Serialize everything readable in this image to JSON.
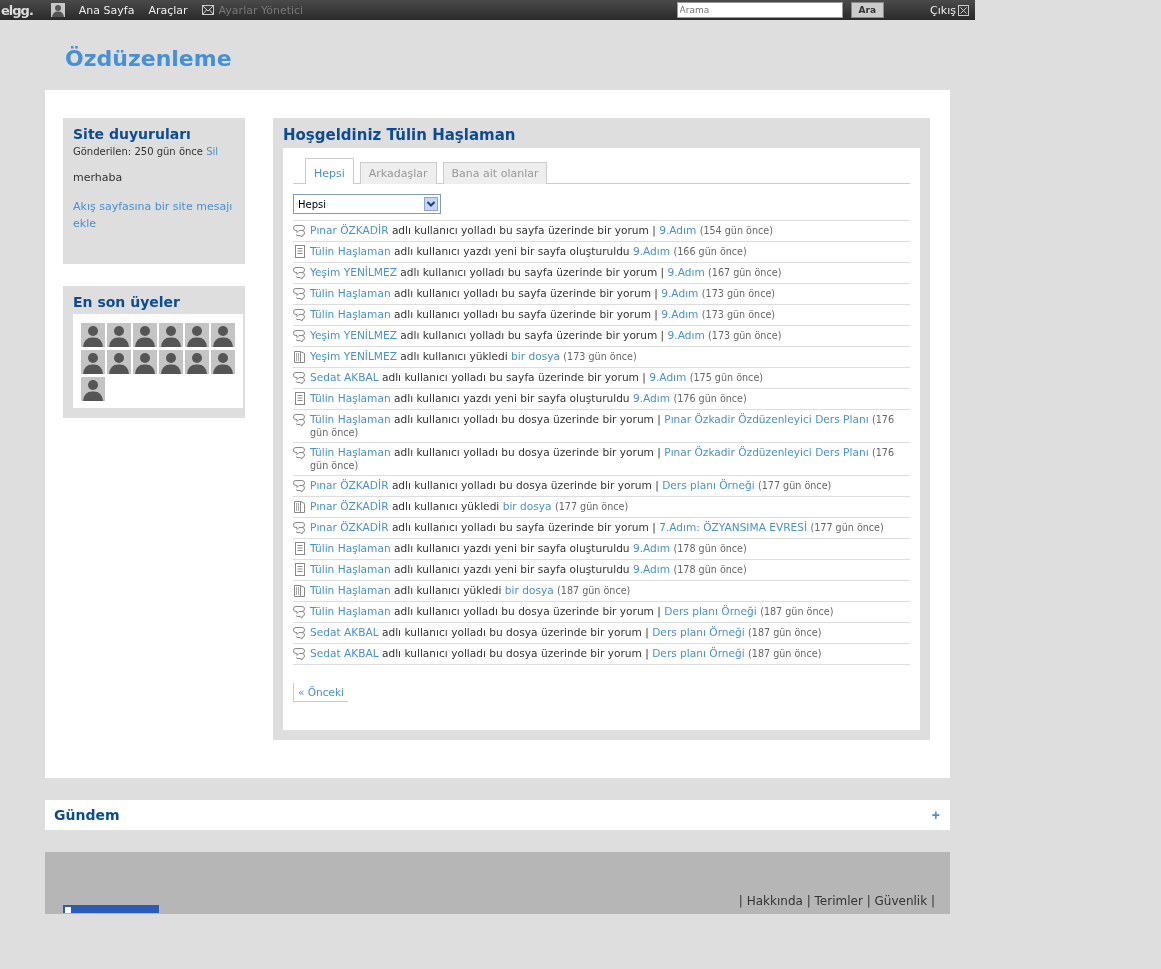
{
  "topbar": {
    "logo": "elgg.",
    "nav": [
      {
        "kind": "avatar"
      },
      {
        "kind": "link",
        "label": "Ana Sayfa",
        "dimmed": false
      },
      {
        "kind": "link",
        "label": "Araçlar",
        "dimmed": false
      },
      {
        "kind": "mail",
        "label": "Ayarlar Yönetici",
        "dimmed": true
      }
    ],
    "search": {
      "placeholder": "Arama",
      "button": "Ara"
    },
    "logout": "Çıkış"
  },
  "page_title": "Özdüzenleme",
  "announcements": {
    "title": "Site duyuruları",
    "posted": "Gönderilen: 250 gün önce",
    "delete": "Sil",
    "message": "merhaba",
    "add_link": "Akış sayfasına bir site mesajı ekle"
  },
  "new_members": {
    "title": "En son üyeler",
    "avatars": [
      {
        "kind": "default"
      },
      {
        "kind": "default"
      },
      {
        "kind": "default"
      },
      {
        "kind": "default"
      },
      {
        "kind": "default"
      },
      {
        "kind": "default"
      },
      {
        "kind": "default"
      },
      {
        "kind": "default"
      },
      {
        "kind": "default"
      },
      {
        "kind": "default"
      },
      {
        "kind": "default"
      },
      {
        "kind": "default"
      },
      {
        "kind": "default"
      }
    ]
  },
  "river": {
    "title": "Hoşgeldiniz Tülin Haşlaman",
    "tabs": [
      {
        "label": "Hepsi",
        "selected": true
      },
      {
        "label": "Arkadaşlar",
        "selected": false
      },
      {
        "label": "Bana ait olanlar",
        "selected": false
      }
    ],
    "filter": "Hepsi",
    "items": [
      {
        "kind": "comment",
        "actor": "Pınar ÖZKADİR",
        "text": "adlı kullanıcı yolladı bu sayfa üzerinde bir yorum |",
        "target": "9.Adım",
        "time": "(154 gün önce)"
      },
      {
        "kind": "page",
        "actor": "Tülin Haşlaman",
        "text": "adlı kullanıcı yazdı yeni bir sayfa oluşturuldu",
        "target": "9.Adım",
        "time": "(166 gün önce)"
      },
      {
        "kind": "comment",
        "actor": "Yeşim YENİLMEZ",
        "text": "adlı kullanıcı yolladı bu sayfa üzerinde bir yorum |",
        "target": "9.Adım",
        "time": "(167 gün önce)"
      },
      {
        "kind": "comment",
        "actor": "Tülin Haşlaman",
        "text": "adlı kullanıcı yolladı bu sayfa üzerinde bir yorum |",
        "target": "9.Adım",
        "time": "(173 gün önce)"
      },
      {
        "kind": "comment",
        "actor": "Tülin Haşlaman",
        "text": "adlı kullanıcı yolladı bu sayfa üzerinde bir yorum |",
        "target": "9.Adım",
        "time": "(173 gün önce)"
      },
      {
        "kind": "comment",
        "actor": "Yeşim YENİLMEZ",
        "text": "adlı kullanıcı yolladı bu sayfa üzerinde bir yorum |",
        "target": "9.Adım",
        "time": "(173 gün önce)"
      },
      {
        "kind": "file",
        "actor": "Yeşim YENİLMEZ",
        "text": "adlı kullanıcı yükledi",
        "target": "bir dosya",
        "time": "(173 gün önce)"
      },
      {
        "kind": "comment",
        "actor": "Sedat AKBAL",
        "text": "adlı kullanıcı yolladı bu sayfa üzerinde bir yorum |",
        "target": "9.Adım",
        "time": "(175 gün önce)"
      },
      {
        "kind": "page",
        "actor": "Tülin Haşlaman",
        "text": "adlı kullanıcı yazdı yeni bir sayfa oluşturuldu",
        "target": "9.Adım",
        "time": "(176 gün önce)"
      },
      {
        "kind": "comment",
        "actor": "Tülin Haşlaman",
        "text": "adlı kullanıcı yolladı bu dosya üzerinde bir yorum |",
        "target": "Pınar Özkadir Özdüzenleyici Ders Planı",
        "time": "(176 gün önce)"
      },
      {
        "kind": "comment",
        "actor": "Tülin Haşlaman",
        "text": "adlı kullanıcı yolladı bu dosya üzerinde bir yorum |",
        "target": "Pınar Özkadir Özdüzenleyici Ders Planı",
        "time": "(176 gün önce)"
      },
      {
        "kind": "comment",
        "actor": "Pınar ÖZKADİR",
        "text": "adlı kullanıcı yolladı bu dosya üzerinde bir yorum |",
        "target": "Ders planı Örneği",
        "time": "(177 gün önce)"
      },
      {
        "kind": "file",
        "actor": "Pınar ÖZKADİR",
        "text": "adlı kullanıcı yükledi",
        "target": "bir dosya",
        "time": "(177 gün önce)"
      },
      {
        "kind": "comment",
        "actor": "Pınar ÖZKADİR",
        "text": "adlı kullanıcı yolladı bu sayfa üzerinde bir yorum |",
        "target": "7.Adım: ÖZYANSIMA EVRESİ",
        "time": "(177 gün önce)"
      },
      {
        "kind": "page",
        "actor": "Tülin Haşlaman",
        "text": "adlı kullanıcı yazdı yeni bir sayfa oluşturuldu",
        "target": "9.Adım",
        "time": "(178 gün önce)"
      },
      {
        "kind": "page",
        "actor": "Tülin Haşlaman",
        "text": "adlı kullanıcı yazdı yeni bir sayfa oluşturuldu",
        "target": "9.Adım",
        "time": "(178 gün önce)"
      },
      {
        "kind": "file",
        "actor": "Tülin Haşlaman",
        "text": "adlı kullanıcı yükledi",
        "target": "bir dosya",
        "time": "(187 gün önce)"
      },
      {
        "kind": "comment",
        "actor": "Tülin Haşlaman",
        "text": "adlı kullanıcı yolladı bu dosya üzerinde bir yorum |",
        "target": "Ders planı Örneği",
        "time": "(187 gün önce)"
      },
      {
        "kind": "comment",
        "actor": "Sedat AKBAL",
        "text": "adlı kullanıcı yolladı bu dosya üzerinde bir yorum |",
        "target": "Ders planı Örneği",
        "time": "(187 gün önce)"
      },
      {
        "kind": "comment",
        "actor": "Sedat AKBAL",
        "text": "adlı kullanıcı yolladı bu dosya üzerinde bir yorum |",
        "target": "Ders planı Örneği",
        "time": "(187 gün önce)"
      }
    ],
    "previous": "« Önceki"
  },
  "trending": {
    "title": "Gündem",
    "toggle": "+"
  },
  "footer": {
    "links": "| Hakkında | Terimler | Güvenlik |"
  }
}
